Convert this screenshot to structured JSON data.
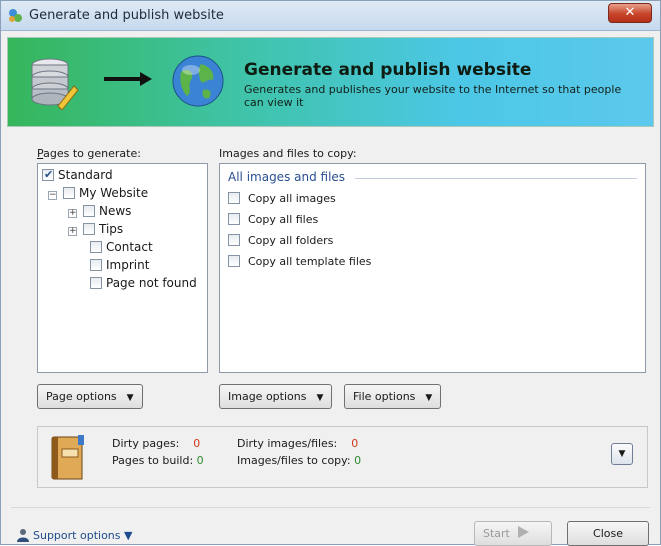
{
  "window": {
    "title": "Generate and publish website",
    "close_glyph": "✕"
  },
  "banner": {
    "heading": "Generate and publish website",
    "subtext": "Generates and publishes your website to the Internet so that people can view it"
  },
  "pages_panel": {
    "label": "Pages to generate:",
    "label_mnemonic": "P",
    "tree": [
      {
        "label": "Standard",
        "checked": true,
        "level": 0
      },
      {
        "label": "My Website",
        "checked": false,
        "level": 1,
        "expander": "−"
      },
      {
        "label": "News",
        "checked": false,
        "level": 2,
        "expander": "+"
      },
      {
        "label": "Tips",
        "checked": false,
        "level": 2,
        "expander": "+"
      },
      {
        "label": "Contact",
        "checked": false,
        "level": 3
      },
      {
        "label": "Imprint",
        "checked": false,
        "level": 3
      },
      {
        "label": "Page not found",
        "checked": false,
        "level": 3
      }
    ]
  },
  "files_panel": {
    "label": "Images and files to copy:",
    "group_title": "All images and files",
    "items": [
      {
        "label": "Copy all images",
        "checked": false
      },
      {
        "label": "Copy all files",
        "checked": false
      },
      {
        "label": "Copy all folders",
        "checked": false
      },
      {
        "label": "Copy all template files",
        "checked": false
      }
    ]
  },
  "buttons": {
    "page_options": "Page options",
    "image_options": "Image options",
    "file_options": "File options",
    "start": "Start",
    "close": "Close",
    "support_options": "Support options"
  },
  "stats": {
    "dirty_pages_label": "Dirty pages:",
    "dirty_pages_value": "0",
    "pages_to_build_label": "Pages to build:",
    "pages_to_build_value": "0",
    "dirty_images_label": "Dirty images/files:",
    "dirty_images_value": "0",
    "images_to_copy_label": "Images/files to copy:",
    "images_to_copy_value": "0"
  },
  "colors": {
    "dirty_value": "#d03a1a",
    "build_value": "#2f8a2f",
    "accent": "#2a4f90"
  }
}
